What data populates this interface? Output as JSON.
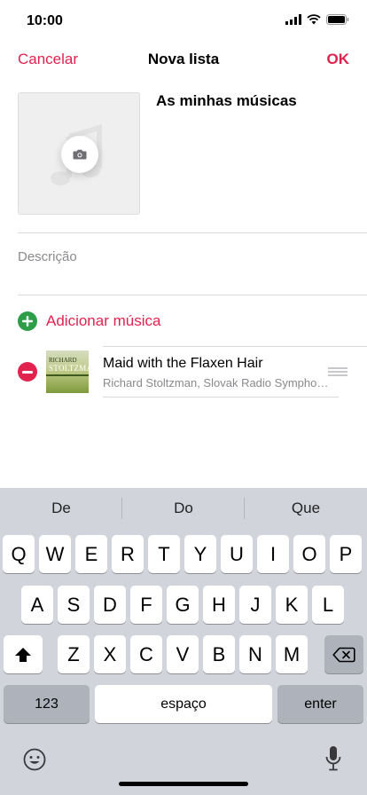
{
  "status_bar": {
    "time": "10:00",
    "icons": [
      "signal-icon",
      "wifi-icon",
      "battery-icon"
    ]
  },
  "nav": {
    "cancel_label": "Cancelar",
    "title": "Nova lista",
    "ok_label": "OK"
  },
  "playlist": {
    "name": "As minhas músicas",
    "artwork_icon": "music-note-icon",
    "camera_icon": "camera-icon",
    "description_placeholder": "Descrição"
  },
  "add_song": {
    "label": "Adicionar música",
    "icon": "plus-circle-icon"
  },
  "songs": [
    {
      "title": "Maid with the Flaxen Hair",
      "artist": "Richard Stoltzman, Slovak Radio Symphony Orchestra",
      "art_text_line1": "RICHARD",
      "art_text_line2": "STOLTZMAN"
    }
  ],
  "keyboard": {
    "suggestions": [
      "De",
      "Do",
      "Que"
    ],
    "row1": [
      "Q",
      "W",
      "E",
      "R",
      "T",
      "Y",
      "U",
      "I",
      "O",
      "P"
    ],
    "row2": [
      "A",
      "S",
      "D",
      "F",
      "G",
      "H",
      "J",
      "K",
      "L"
    ],
    "row3": [
      "Z",
      "X",
      "C",
      "V",
      "B",
      "N",
      "M"
    ],
    "numbers_label": "123",
    "space_label": "espaço",
    "enter_label": "enter"
  },
  "colors": {
    "accent": "#e2224e",
    "add_green": "#2e9d48",
    "keyboard_bg": "#d1d4db"
  }
}
